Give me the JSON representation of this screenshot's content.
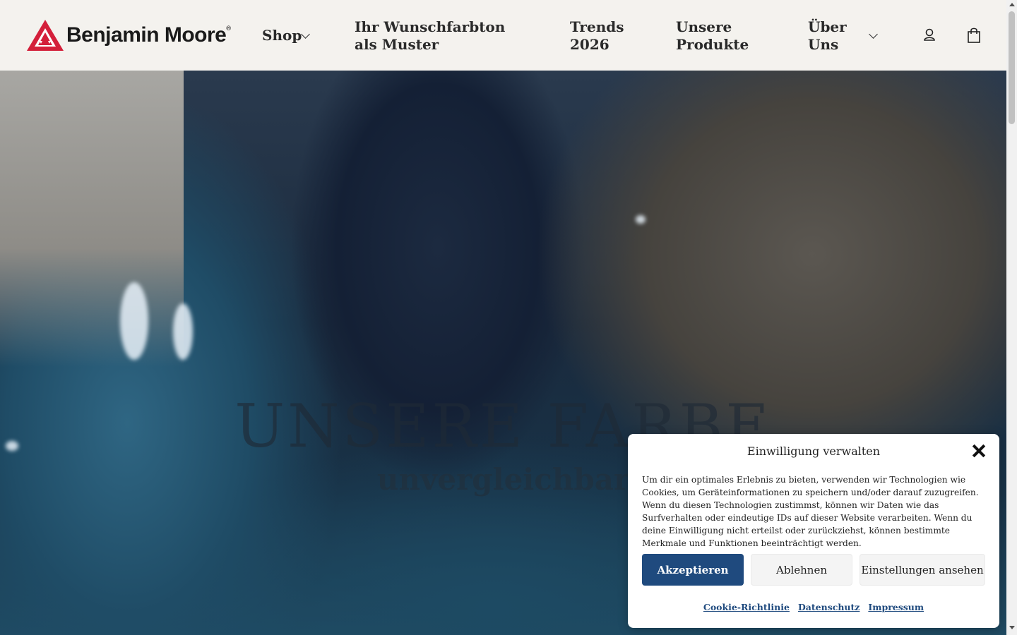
{
  "brand": {
    "name": "Benjamin Moore",
    "registered": "®",
    "accent": "#d41f3a"
  },
  "nav": {
    "shop": "Shop",
    "sample": "Ihr Wunschfarbton als Muster",
    "trends": "Trends 2026",
    "products": "Unsere Produkte",
    "about": "Über Uns",
    "icons": [
      "user-icon",
      "shopping-bag-icon",
      "chevron-down-icon"
    ]
  },
  "hero": {
    "title": "UNSERE FARBE",
    "subtitle": "unvergleichbar"
  },
  "consent": {
    "title": "Einwilligung verwalten",
    "text": "Um dir ein optimales Erlebnis zu bieten, verwenden wir Technologien wie Cookies, um Geräteinformationen zu speichern und/oder darauf zuzugreifen. Wenn du diesen Technologien zustimmst, können wir Daten wie das Surfverhalten oder eindeutige IDs auf dieser Website verarbeiten. Wenn du deine Einwilligung nicht erteilst oder zurückziehst, können bestimmte Merkmale und Funktionen beeinträchtigt werden.",
    "accept": "Akzeptieren",
    "deny": "Ablehnen",
    "preferences": "Einstellungen ansehen",
    "links": {
      "cookie_policy": "Cookie-Richtlinie",
      "privacy": "Datenschutz",
      "imprint": "Impressum"
    },
    "accent": "#1f4a7e"
  }
}
